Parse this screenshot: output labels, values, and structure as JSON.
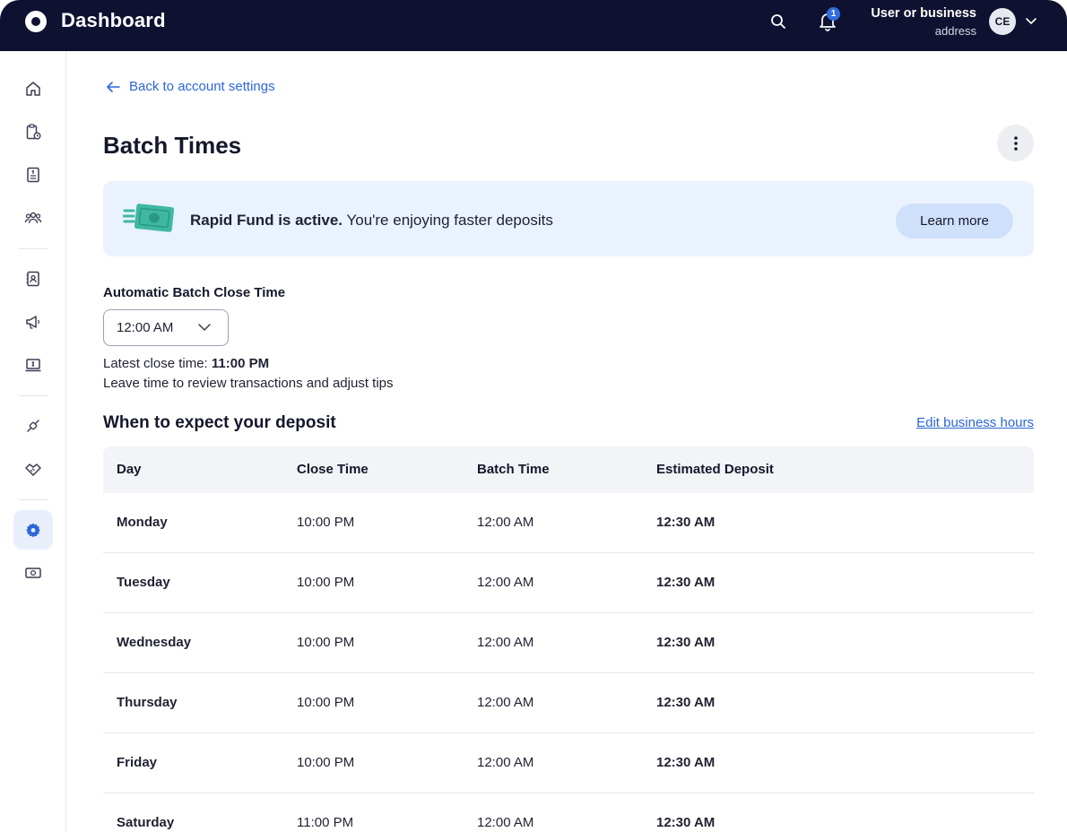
{
  "header": {
    "title": "Dashboard",
    "notification_count": "1",
    "user_name": "User or business",
    "user_sub": "address",
    "avatar_initials": "CE"
  },
  "sidebar": {
    "items": [
      {
        "name": "home",
        "icon": "home-icon"
      },
      {
        "name": "orders",
        "icon": "clipboard-clock-icon"
      },
      {
        "name": "invoices",
        "icon": "document-dollar-icon"
      },
      {
        "name": "customers",
        "icon": "people-icon"
      },
      {
        "name": "contacts",
        "icon": "contact-book-icon"
      },
      {
        "name": "marketing",
        "icon": "megaphone-icon"
      },
      {
        "name": "payments",
        "icon": "laptop-dollar-icon"
      },
      {
        "name": "integrations",
        "icon": "plug-icon"
      },
      {
        "name": "partners",
        "icon": "handshake-icon"
      },
      {
        "name": "settings",
        "icon": "gear-icon",
        "active": true
      },
      {
        "name": "funding",
        "icon": "cash-icon"
      }
    ]
  },
  "back_link": "Back to account settings",
  "page_title": "Batch Times",
  "banner": {
    "bold": "Rapid Fund is active.",
    "text": " You're enjoying faster deposits",
    "button": "Learn more"
  },
  "batch_close": {
    "label": "Automatic Batch Close Time",
    "value": "12:00 AM",
    "latest_prefix": "Latest close time: ",
    "latest_value": "11:00 PM",
    "helper": "Leave time to review transactions and adjust tips"
  },
  "deposit": {
    "title": "When to expect your deposit",
    "edit_link": "Edit business hours",
    "columns": [
      "Day",
      "Close Time",
      "Batch Time",
      "Estimated Deposit"
    ],
    "rows": [
      [
        "Monday",
        "10:00 PM",
        "12:00 AM",
        "12:30 AM"
      ],
      [
        "Tuesday",
        "10:00 PM",
        "12:00 AM",
        "12:30 AM"
      ],
      [
        "Wednesday",
        "10:00 PM",
        "12:00 AM",
        "12:30 AM"
      ],
      [
        "Thursday",
        "10:00 PM",
        "12:00 AM",
        "12:30 AM"
      ],
      [
        "Friday",
        "10:00 PM",
        "12:00 AM",
        "12:30 AM"
      ],
      [
        "Saturday",
        "11:00 PM",
        "12:00 AM",
        "12:30 AM"
      ]
    ]
  },
  "colors": {
    "topbar": "#0f1131",
    "accent": "#2b66d9",
    "banner_bg": "#eaf2fe",
    "button_bg": "#cfe0fa"
  }
}
